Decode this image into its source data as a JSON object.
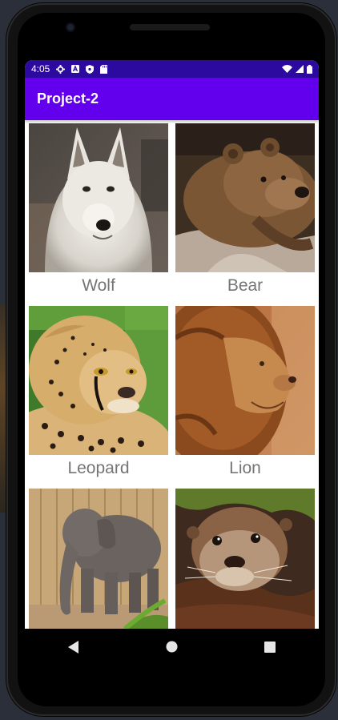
{
  "status_bar": {
    "time": "4:05",
    "left_icons": [
      "settings-icon",
      "font-icon",
      "shield-icon",
      "sd-card-icon"
    ],
    "right_icons": [
      "wifi-icon",
      "signal-icon",
      "battery-icon"
    ]
  },
  "app_bar": {
    "title": "Project-2"
  },
  "grid": {
    "items": [
      {
        "label": "Wolf",
        "image": "wolf-photo"
      },
      {
        "label": "Bear",
        "image": "bear-photo"
      },
      {
        "label": "Leopard",
        "image": "leopard-photo"
      },
      {
        "label": "Lion",
        "image": "lion-photo"
      },
      {
        "label": "",
        "image": "elephant-photo"
      },
      {
        "label": "",
        "image": "otter-photo"
      }
    ]
  },
  "nav_bar": {
    "buttons": [
      "back-icon",
      "home-icon",
      "recents-icon"
    ]
  },
  "colors": {
    "status_bar": "#2c0aa0",
    "app_bar": "#6200ee",
    "label_text": "#757575"
  }
}
